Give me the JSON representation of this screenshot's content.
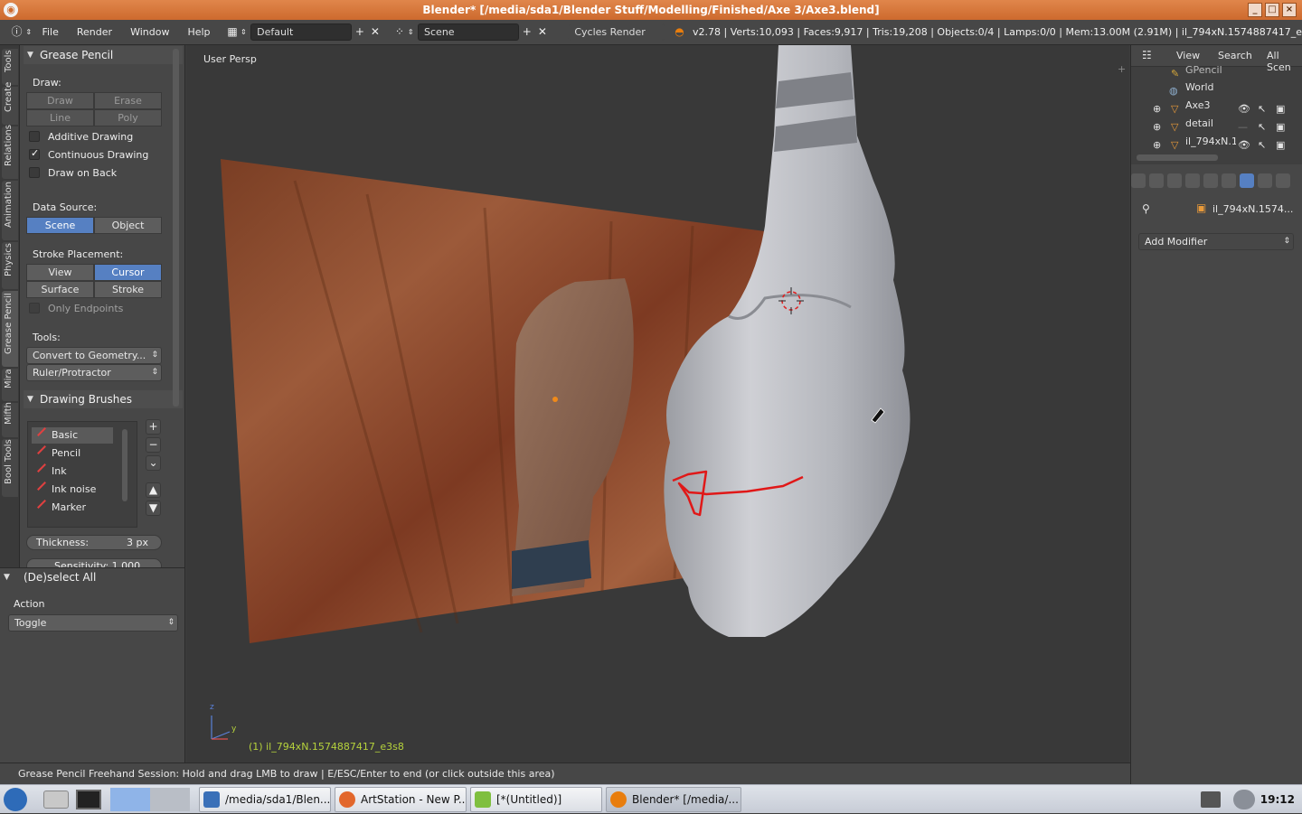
{
  "window": {
    "title": "Blender* [/media/sda1/Blender Stuff/Modelling/Finished/Axe 3/Axe3.blend]",
    "controls": [
      "_",
      "□",
      "×"
    ]
  },
  "infobar": {
    "menus": [
      "File",
      "Render",
      "Window",
      "Help"
    ],
    "screen_layout": "Default",
    "scene": "Scene",
    "render_engine": "Cycles Render",
    "stats": "v2.78 | Verts:10,093 | Faces:9,917 | Tris:19,208 | Objects:0/4 | Lamps:0/0 | Mem:13.00M (2.91M) | il_794xN.1574887417_e"
  },
  "toolstrip_tabs": [
    "Tools",
    "Create",
    "Relations",
    "Animation",
    "Physics",
    "Grease Pencil",
    "Mira",
    "Mifth",
    "Bool Tools"
  ],
  "grease_pencil": {
    "header": "Grease Pencil",
    "draw_label": "Draw:",
    "draw_buttons": [
      "Draw",
      "Erase",
      "Line",
      "Poly"
    ],
    "additive": "Additive Drawing",
    "continuous": "Continuous Drawing",
    "draw_on_back": "Draw on Back",
    "data_source_label": "Data Source:",
    "data_source": [
      "Scene",
      "Object"
    ],
    "stroke_placement_label": "Stroke Placement:",
    "stroke_placement": [
      "View",
      "Cursor",
      "Surface",
      "Stroke"
    ],
    "only_endpoints": "Only Endpoints",
    "tools_label": "Tools:",
    "convert": "Convert to Geometry...",
    "ruler": "Ruler/Protractor"
  },
  "drawing_brushes": {
    "header": "Drawing Brushes",
    "items": [
      "Basic",
      "Pencil",
      "Ink",
      "Ink noise",
      "Marker"
    ],
    "thickness_label": "Thickness:",
    "thickness_value": "3 px",
    "sensitivity": "Sensitivity: 1.000"
  },
  "redo_panel": {
    "header": "(De)select All",
    "action_label": "Action",
    "action_value": "Toggle"
  },
  "viewport": {
    "view_name": "User Persp",
    "active_object": "(1) il_794xN.1574887417_e3s8",
    "axis_z": "z",
    "axis_y": "y"
  },
  "outliner": {
    "menus": [
      "View",
      "Search",
      "All Scen"
    ],
    "rows": [
      "GPencil",
      "World",
      "Axe3",
      "detail",
      "il_794xN.1"
    ]
  },
  "properties": {
    "object_name": "il_794xN.1574...",
    "add_modifier": "Add Modifier"
  },
  "status": "Grease Pencil Freehand Session: Hold and drag LMB to draw | E/ESC/Enter to end  (or click outside this area)",
  "taskbar": {
    "tasks": [
      "/media/sda1/Blen...",
      "ArtStation - New P...",
      "[*(Untitled)]",
      "Blender* [/media/..."
    ],
    "clock": "19:12"
  },
  "colors": {
    "accent": "#5680c2",
    "title_bar": "#cd6a2e",
    "stroke": "#e01818",
    "active_text": "#b6d23c"
  }
}
